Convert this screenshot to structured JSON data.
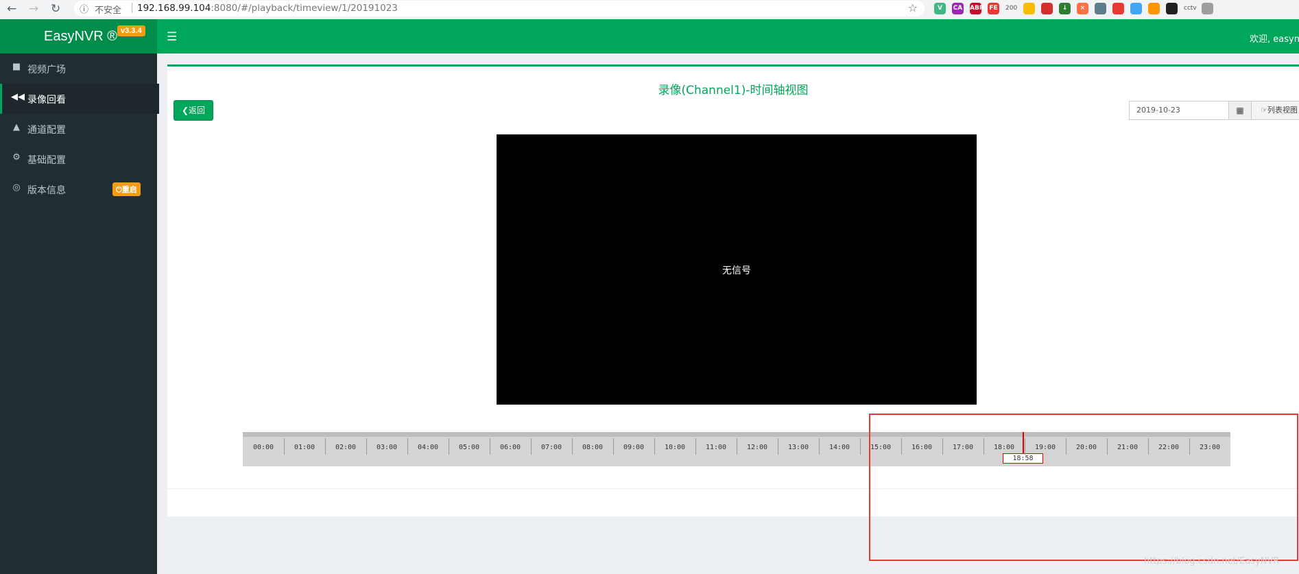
{
  "browser": {
    "security_label": "不安全",
    "url_host": "192.168.99.104",
    "url_rest": ":8080/#/playback/timeview/1/20191023",
    "extensions": [
      {
        "name": "vue-devtools-icon",
        "label": "V",
        "color": "#41b883"
      },
      {
        "name": "color-picker-icon",
        "label": "CA",
        "color": "#9c27b0"
      },
      {
        "name": "adblock-plus-icon",
        "label": "ABP",
        "color": "#c70d2c"
      },
      {
        "name": "fe-helper-icon",
        "label": "FE",
        "color": "#e53935"
      },
      {
        "name": "counter-badge-icon",
        "label": "200",
        "color": "#f1f3f4"
      },
      {
        "name": "google-drive-icon",
        "label": "",
        "color": "#fbbc04"
      },
      {
        "name": "stop-icon",
        "label": "",
        "color": "#d32f2f"
      },
      {
        "name": "download-icon",
        "label": "↓",
        "color": "#2e7d32"
      },
      {
        "name": "close-circle-icon",
        "label": "×",
        "color": "#ff7043"
      },
      {
        "name": "face-icon",
        "label": "",
        "color": "#607d8b"
      },
      {
        "name": "red-icon",
        "label": "",
        "color": "#e53935"
      },
      {
        "name": "blue-icon",
        "label": "",
        "color": "#42a5f5"
      },
      {
        "name": "orange-icon",
        "label": "",
        "color": "#ff9800"
      },
      {
        "name": "clipboard-icon",
        "label": "",
        "color": "#212121"
      },
      {
        "name": "cctv-icon",
        "label": "cctv",
        "color": "#f1f3f4"
      },
      {
        "name": "profile-avatar-icon",
        "label": "",
        "color": "#9e9e9e"
      }
    ]
  },
  "header": {
    "brand": "EasyNVR ®",
    "version": "v3.3.4",
    "welcome": "欢迎, easyn"
  },
  "sidebar": {
    "items": [
      {
        "label": "视频广场",
        "icon": "video-camera-icon",
        "glyph": "■"
      },
      {
        "label": "录像回看",
        "icon": "backward-icon",
        "glyph": "◀◀"
      },
      {
        "label": "通道配置",
        "icon": "road-icon",
        "glyph": "▲"
      },
      {
        "label": "基础配置",
        "icon": "gears-icon",
        "glyph": "⚙"
      },
      {
        "label": "版本信息",
        "icon": "globe-icon",
        "glyph": "◎"
      }
    ],
    "restart_label": "⏻重启"
  },
  "main": {
    "title": "录像(Channel1)-时间轴视图",
    "back_label": "❮返回",
    "date_value": "2019-10-23",
    "calendar_glyph": "▦",
    "list_view_label": "☞列表视图",
    "player_status": "无信号"
  },
  "timeline": {
    "hours": [
      "00:00",
      "01:00",
      "02:00",
      "03:00",
      "04:00",
      "05:00",
      "06:00",
      "07:00",
      "08:00",
      "09:00",
      "10:00",
      "11:00",
      "12:00",
      "13:00",
      "14:00",
      "15:00",
      "16:00",
      "17:00",
      "18:00",
      "19:00",
      "20:00",
      "21:00",
      "22:00",
      "23:00"
    ],
    "current_time": "18:58",
    "current_minutes": 1138
  },
  "watermark": "https://blog.csdn.net/EasyNVR",
  "colors": {
    "accent": "#00a65a",
    "sidebar": "#222d32",
    "badge": "#f39c12",
    "highlight": "#e53935"
  }
}
